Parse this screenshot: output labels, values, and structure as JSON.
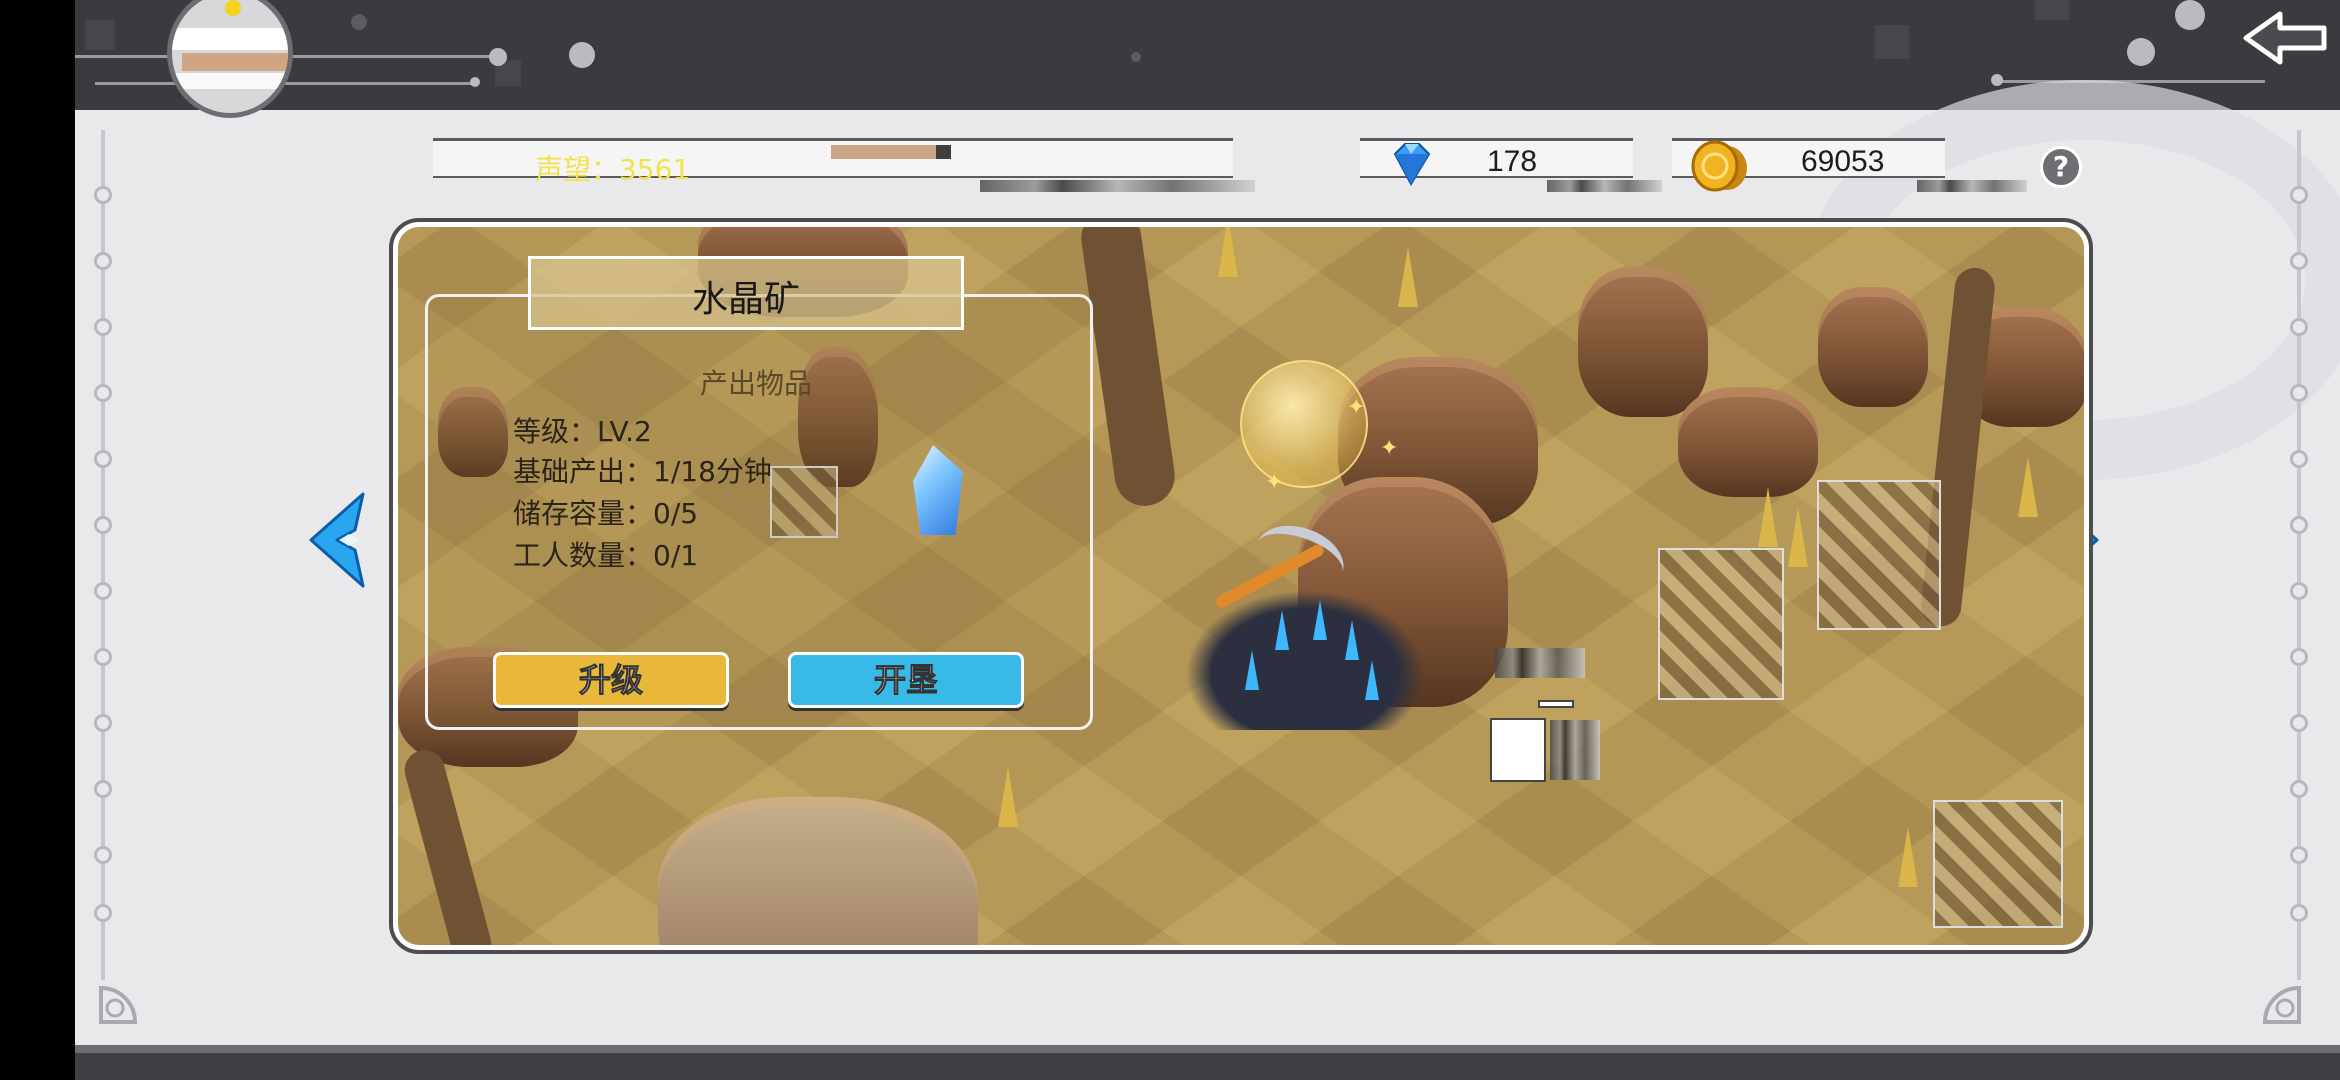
{
  "header": {
    "back_icon": "back-arrow-icon",
    "avatar_icon": "player-avatar"
  },
  "resources": {
    "reputation_label": "声望：3561",
    "reputation_progress": 0.26,
    "diamond_icon": "diamond-icon",
    "diamond_value": "178",
    "gold_icon": "gold-coin-icon",
    "gold_value": "69053",
    "help_label": "?"
  },
  "building": {
    "name": "水晶矿",
    "produce_label": "产出物品",
    "level_line": "等级：LV.2",
    "base_output_line": "基础产出：1/18分钟",
    "storage_line": "储存容量：0/5",
    "worker_line": "工人数量：0/1",
    "produce_icon": "crystal-icon"
  },
  "actions": {
    "upgrade_label": "升级",
    "develop_label": "开垦"
  },
  "navigation": {
    "prev_icon": "chevron-left-icon",
    "next_icon": "chevron-right-icon"
  },
  "colors": {
    "upgrade": "#e9b73a",
    "develop": "#38b9e8",
    "reputation_text": "#f3e24d",
    "arrow": "#2aa6f0"
  }
}
